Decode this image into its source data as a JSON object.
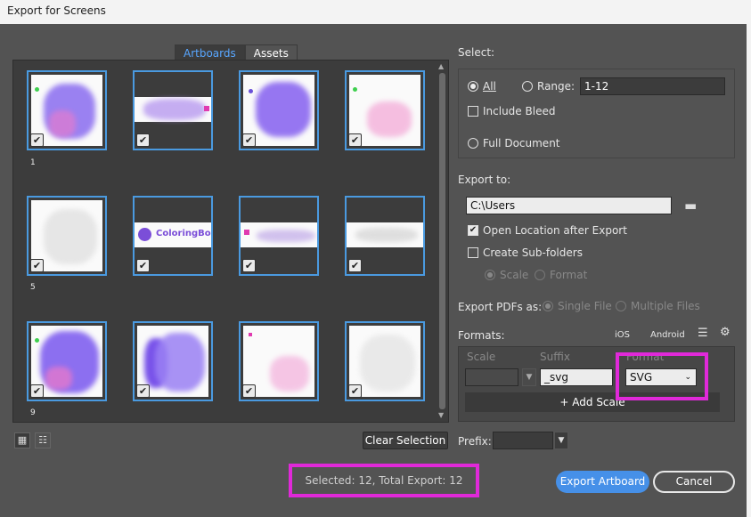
{
  "window": {
    "title": "Export for Screens"
  },
  "tabs": [
    {
      "label": "Artboards"
    },
    {
      "label": "Assets"
    }
  ],
  "artboards": [
    {
      "num": "1"
    },
    {
      "num": ""
    },
    {
      "num": ""
    },
    {
      "num": ""
    },
    {
      "num": "5"
    },
    {
      "num": ""
    },
    {
      "num": ""
    },
    {
      "num": ""
    },
    {
      "num": "9"
    },
    {
      "num": ""
    },
    {
      "num": ""
    },
    {
      "num": ""
    }
  ],
  "artboard_brand_text": "ColoringBook",
  "grid": {
    "clear_selection": "Clear Selection"
  },
  "status": {
    "text": "Selected: 12, Total Export: 12"
  },
  "select": {
    "heading": "Select:",
    "all_label": "All",
    "range_label": "Range:",
    "range_value": "1-12",
    "include_bleed": "Include Bleed",
    "full_document": "Full Document"
  },
  "export_to": {
    "heading": "Export to:",
    "path": "C:\\Users",
    "open_location": "Open Location after Export",
    "create_subfolders": "Create Sub-folders",
    "scale_option": "Scale",
    "format_option": "Format"
  },
  "export_pdfs": {
    "heading": "Export PDFs as:",
    "single": "Single File",
    "multiple": "Multiple Files"
  },
  "formats": {
    "heading": "Formats:",
    "ios": "iOS",
    "android": "Android",
    "col_scale": "Scale",
    "col_suffix": "Suffix",
    "col_format": "Format",
    "suffix_value": "_svg",
    "format_value": "SVG",
    "add_scale": "Add Scale"
  },
  "prefix": {
    "label": "Prefix:",
    "value": ""
  },
  "buttons": {
    "export": "Export Artboard",
    "cancel": "Cancel"
  },
  "colors": {
    "accent": "#4690e8",
    "highlight": "#e029d9",
    "panel": "#3c3c3c",
    "dialog": "#535353"
  }
}
